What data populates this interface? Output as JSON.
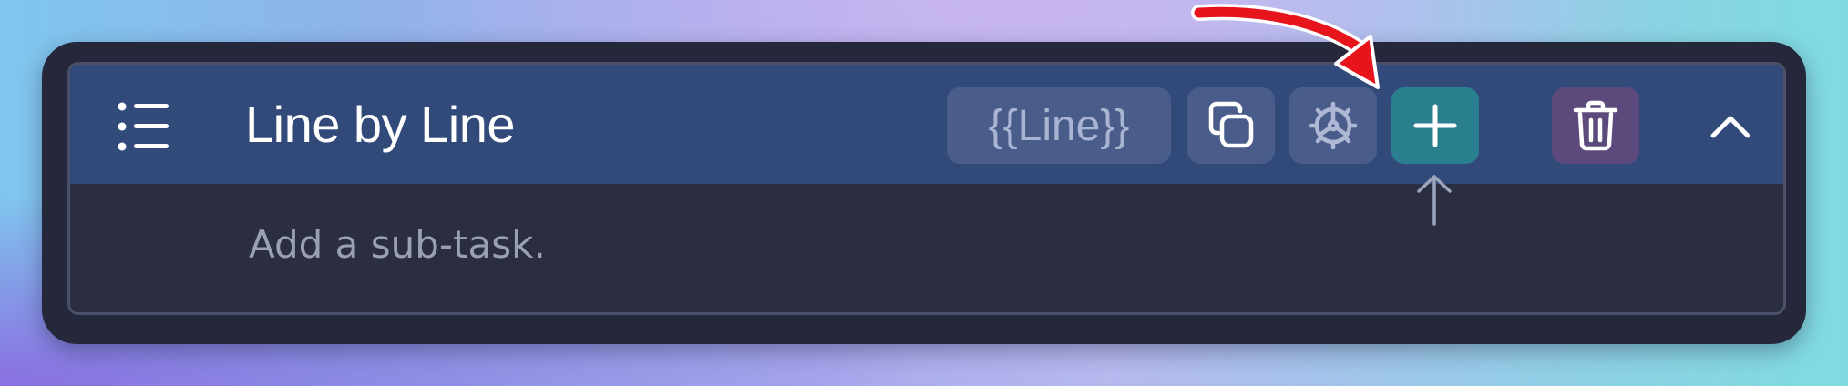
{
  "task": {
    "title": "Line by Line",
    "variable_chip": "{{Line}}",
    "subtask_placeholder": "Add a sub-task."
  },
  "icons": {
    "list": "list-icon",
    "copy": "copy-icon",
    "gear": "gear-icon",
    "add": "plus-icon",
    "delete": "trash-icon",
    "collapse": "chevron-up-icon"
  },
  "colors": {
    "header_bg": "#324a7a",
    "card_bg": "#2a2e3f",
    "add_button": "#2a7f8e",
    "delete_button": "#5b4a7b",
    "annotation_arrow": "#e8141b"
  }
}
